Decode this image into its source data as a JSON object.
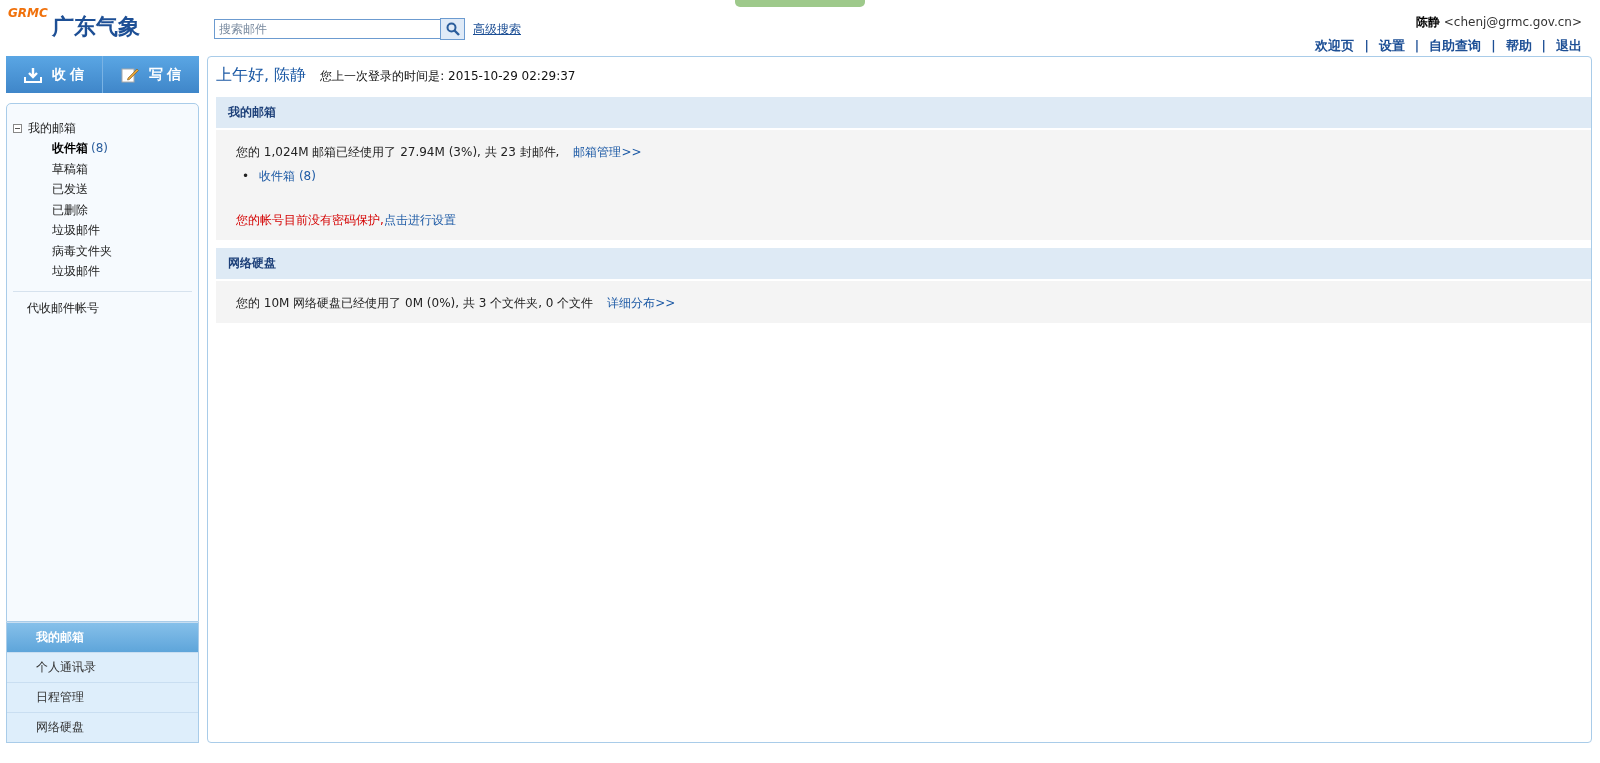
{
  "header": {
    "logo": {
      "mark": "GRMC",
      "title": "广东气象"
    },
    "search": {
      "placeholder": "搜索邮件"
    },
    "advanced_search": "高级搜索",
    "user": {
      "name": "陈静",
      "email": "<chenj@grmc.gov.cn>"
    },
    "nav": [
      "欢迎页",
      "设置",
      "自助查询",
      "帮助",
      "退出"
    ],
    "nav_separator": "|"
  },
  "sidebar": {
    "actions": [
      {
        "label": "收 信",
        "kind": "receive"
      },
      {
        "label": "写 信",
        "kind": "compose"
      }
    ],
    "tree": {
      "label": "我的邮箱",
      "expanded": true,
      "children": [
        {
          "label": "收件箱",
          "count": "(8)",
          "selected": true
        },
        {
          "label": "草稿箱",
          "selected": false
        },
        {
          "label": "已发送",
          "selected": false
        },
        {
          "label": "已删除",
          "selected": false
        },
        {
          "label": "垃圾邮件",
          "selected": false
        },
        {
          "label": "病毒文件夹",
          "selected": false
        },
        {
          "label": "垃圾邮件",
          "selected": false
        }
      ]
    },
    "extra": "代收邮件帐号",
    "bottom_tabs": [
      {
        "label": "我的邮箱",
        "selected": true
      },
      {
        "label": "个人通讯录",
        "selected": false
      },
      {
        "label": "日程管理",
        "selected": false
      },
      {
        "label": "网络硬盘",
        "selected": false
      }
    ]
  },
  "main": {
    "greeting": "上午好, 陈静",
    "last_login": "您上一次登录的时间是: 2015-10-29 02:29:37",
    "mailbox": {
      "title": "我的邮箱",
      "usage": "您的 1,024M 邮箱已经使用了 27.94M (3%), 共 23 封邮件,",
      "manage_link": "邮箱管理>>",
      "folders": [
        {
          "bullet": "•",
          "label": "收件箱 (8)"
        }
      ],
      "warning": "您的帐号目前没有密码保护,",
      "warning_link": "点击进行设置"
    },
    "disk": {
      "title": "网络硬盘",
      "usage": "您的 10M 网络硬盘已经使用了 0M (0%), 共 3 个文件夹, 0 个文件",
      "detail_link": "详细分布>>"
    }
  }
}
